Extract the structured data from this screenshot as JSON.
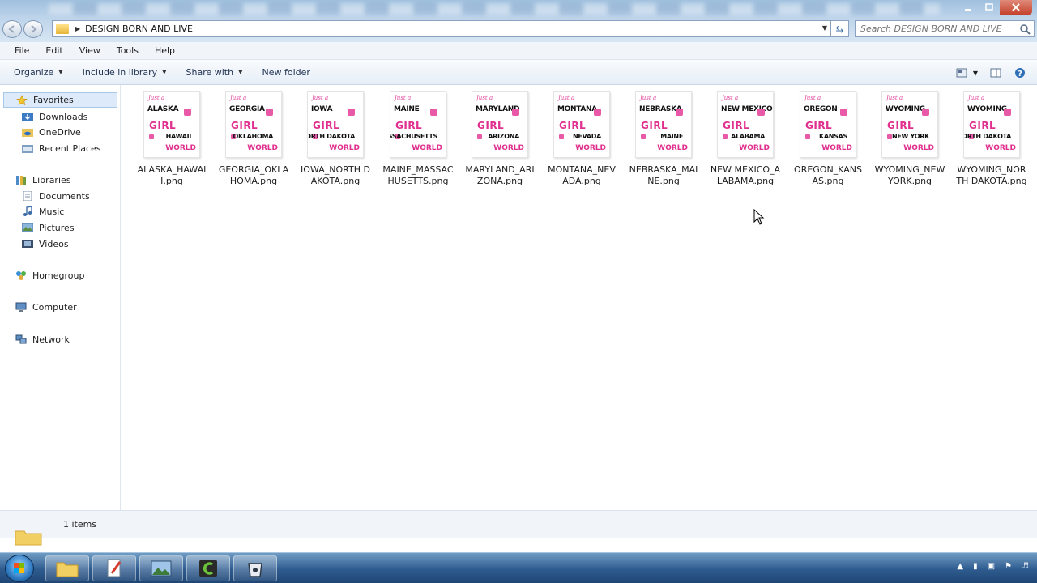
{
  "window": {
    "path_folder": "DESIGN BORN AND LIVE",
    "search_placeholder": "Search DESIGN BORN AND LIVE"
  },
  "menu": [
    "File",
    "Edit",
    "View",
    "Tools",
    "Help"
  ],
  "commands": [
    "Organize",
    "Include in library",
    "Share with",
    "New folder"
  ],
  "nav": {
    "favorites": "Favorites",
    "downloads": "Downloads",
    "onedrive": "OneDrive",
    "recent": "Recent Places",
    "libraries": "Libraries",
    "documents": "Documents",
    "music": "Music",
    "pictures": "Pictures",
    "videos": "Videos",
    "homegroup": "Homegroup",
    "computer": "Computer",
    "network": "Network"
  },
  "files": [
    {
      "name": "ALASKA_HAWAII.png",
      "state1": "ALASKA",
      "state2": "HAWAII"
    },
    {
      "name": "GEORGIA_OKLAHOMA.png",
      "state1": "GEORGIA",
      "state2": "OKLAHOMA"
    },
    {
      "name": "IOWA_NORTH DAKOTA.png",
      "state1": "IOWA",
      "state2": "NORTH DAKOTA"
    },
    {
      "name": "MAINE_MASSACHUSETTS.png",
      "state1": "MAINE",
      "state2": "MASSACHUSETTS"
    },
    {
      "name": "MARYLAND_ARIZONA.png",
      "state1": "MARYLAND",
      "state2": "ARIZONA"
    },
    {
      "name": "MONTANA_NEVADA.png",
      "state1": "MONTANA",
      "state2": "NEVADA"
    },
    {
      "name": "NEBRASKA_MAINE.png",
      "state1": "NEBRASKA",
      "state2": "MAINE"
    },
    {
      "name": "NEW MEXICO_ALABAMA.png",
      "state1": "NEW MEXICO",
      "state2": "ALABAMA"
    },
    {
      "name": "OREGON_KANSAS.png",
      "state1": "OREGON",
      "state2": "KANSAS"
    },
    {
      "name": "WYOMING_NEW YORK.png",
      "state1": "WYOMING",
      "state2": "NEW YORK"
    },
    {
      "name": "WYOMING_NORTH DAKOTA.png",
      "state1": "WYOMING",
      "state2": "NORTH DAKOTA"
    }
  ],
  "thumb_text": {
    "just": "Just a",
    "girl": "GIRL",
    "world": "WORLD"
  },
  "status": {
    "items": "1 items"
  }
}
